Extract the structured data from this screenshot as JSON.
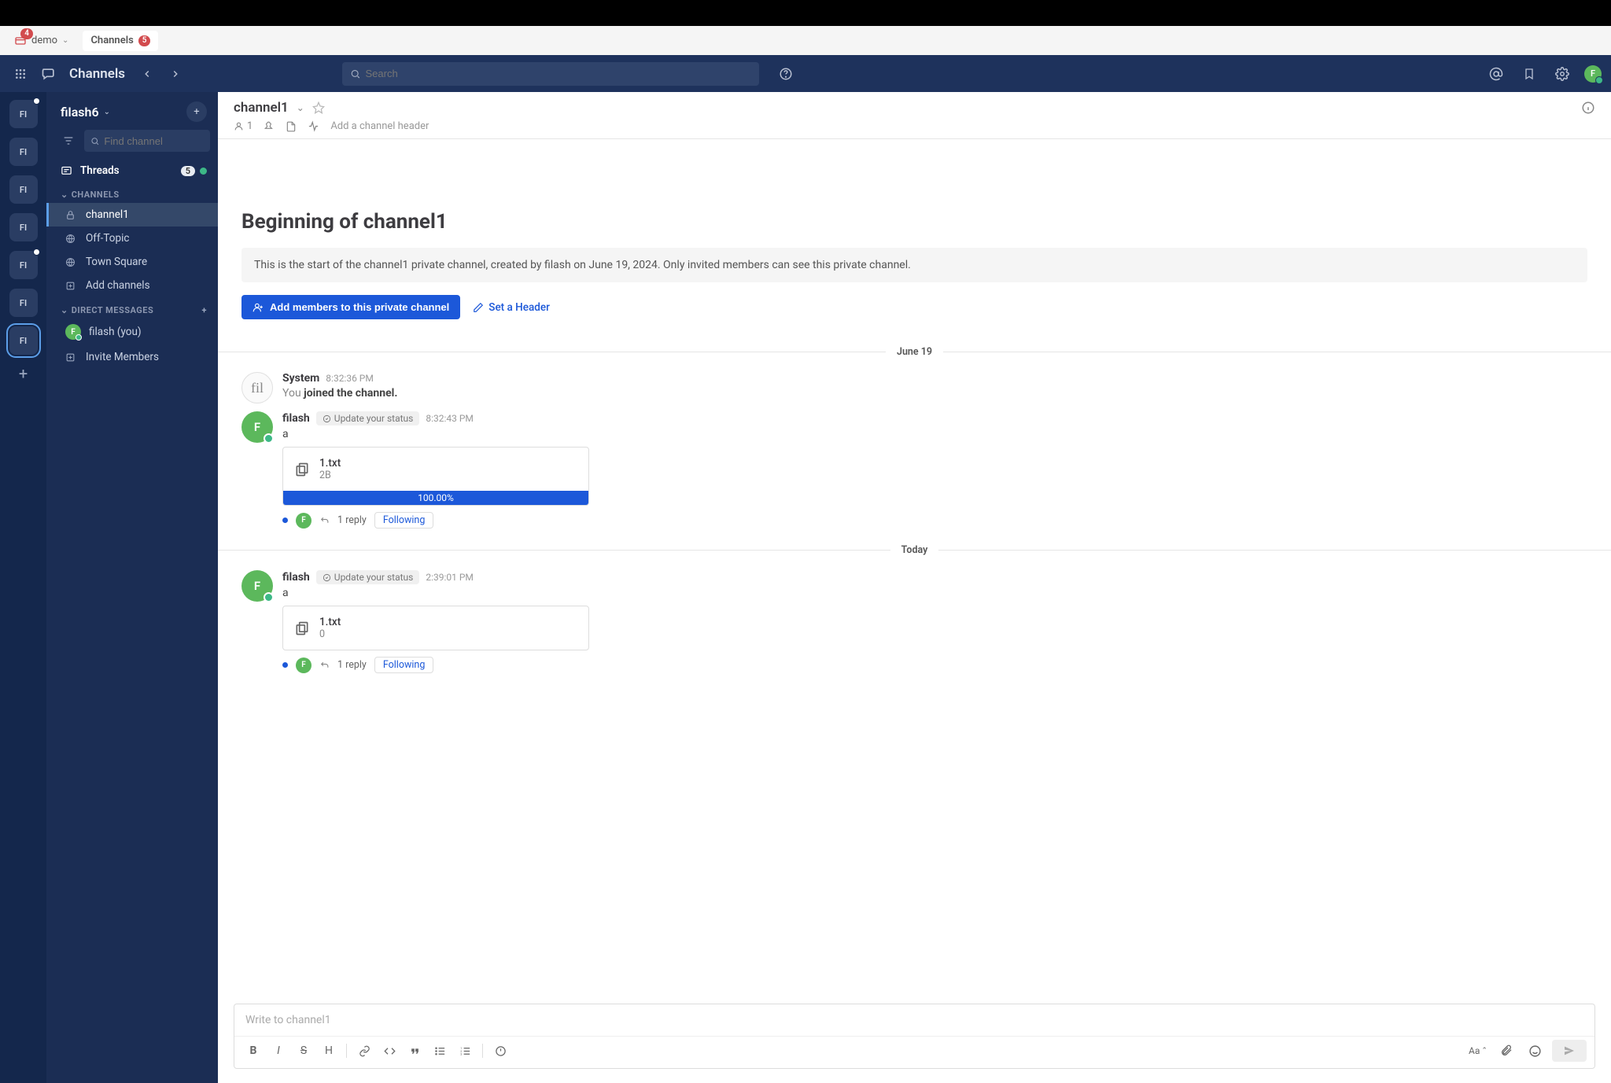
{
  "windowbar": {
    "demo_label": "demo",
    "demo_badge": "4",
    "channels_label": "Channels",
    "channels_badge": "5"
  },
  "header": {
    "title": "Channels",
    "search_placeholder": "Search"
  },
  "workspaces": {
    "labels": [
      "FI",
      "FI",
      "FI",
      "FI",
      "FI",
      "FI",
      "FI"
    ],
    "active_index": 6
  },
  "sidebar": {
    "team_name": "filash6",
    "find_placeholder": "Find channel",
    "threads_label": "Threads",
    "threads_badge": "5",
    "section_channels": "CHANNELS",
    "section_dm": "DIRECT MESSAGES",
    "channels": [
      {
        "name": "channel1",
        "icon": "lock"
      },
      {
        "name": "Off-Topic",
        "icon": "globe"
      },
      {
        "name": "Town Square",
        "icon": "globe"
      }
    ],
    "add_channels_label": "Add channels",
    "dms": [
      {
        "name": "filash (you)"
      }
    ],
    "invite_label": "Invite Members"
  },
  "channel_header": {
    "name": "channel1",
    "member_count": "1",
    "header_placeholder": "Add a channel header"
  },
  "intro": {
    "title": "Beginning of channel1",
    "desc": "This is the start of the channel1 private channel, created by filash on June 19, 2024. Only invited members can see this private channel.",
    "add_members": "Add members to this private channel",
    "set_header": "Set a Header"
  },
  "dates": {
    "d1": "June 19",
    "d2": "Today"
  },
  "messages": {
    "sys": {
      "name": "System",
      "time": "8:32:36 PM",
      "prefix": "You ",
      "text": "joined the channel."
    },
    "m1": {
      "name": "filash",
      "status": "Update your status",
      "time": "8:32:43 PM",
      "text": "a",
      "file_name": "1.txt",
      "file_size": "2B",
      "progress": "100.00%",
      "reply_count": "1 reply",
      "follow": "Following"
    },
    "m2": {
      "name": "filash",
      "status": "Update your status",
      "time": "2:39:01 PM",
      "text": "a",
      "file_name": "1.txt",
      "file_size": "0",
      "reply_count": "1 reply",
      "follow": "Following"
    }
  },
  "composer": {
    "placeholder": "Write to channel1",
    "aa": "Aa"
  }
}
